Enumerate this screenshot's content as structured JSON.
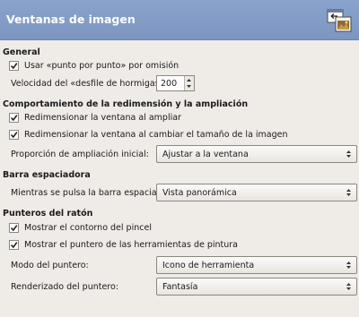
{
  "header": {
    "title": "Ventanas de imagen",
    "icon": "image-windows-icon"
  },
  "general": {
    "title": "General",
    "dot_for_dot": {
      "label": "Usar «punto por punto» por omisión",
      "checked": true
    },
    "marching_ants": {
      "label": "Velocidad del «desfile de hormigas»:",
      "value": "200"
    }
  },
  "zoom": {
    "title": "Comportamiento de la redimensión y la ampliación",
    "resize_on_zoom": {
      "label": "Redimensionar la ventana al ampliar",
      "checked": true
    },
    "resize_on_change": {
      "label": "Redimensionar la ventana al cambiar el tamaño de la imagen",
      "checked": true
    },
    "initial_zoom": {
      "label": "Proporción de ampliación inicial:",
      "value": "Ajustar a la ventana"
    }
  },
  "space_bar": {
    "title": "Barra espaciadora",
    "while_pressed": {
      "label": "Mientras se pulsa la barra espaciadora:",
      "value": "Vista panorámica"
    }
  },
  "pointers": {
    "title": "Punteros del ratón",
    "brush_outline": {
      "label": "Mostrar el contorno del pincel",
      "checked": true
    },
    "paint_tool_pointer": {
      "label": "Mostrar el puntero de las herramientas de pintura",
      "checked": true
    },
    "pointer_mode": {
      "label": "Modo del puntero:",
      "value": "Icono de herramienta"
    },
    "pointer_rendering": {
      "label": "Renderizado del puntero:",
      "value": "Fantasía"
    }
  }
}
